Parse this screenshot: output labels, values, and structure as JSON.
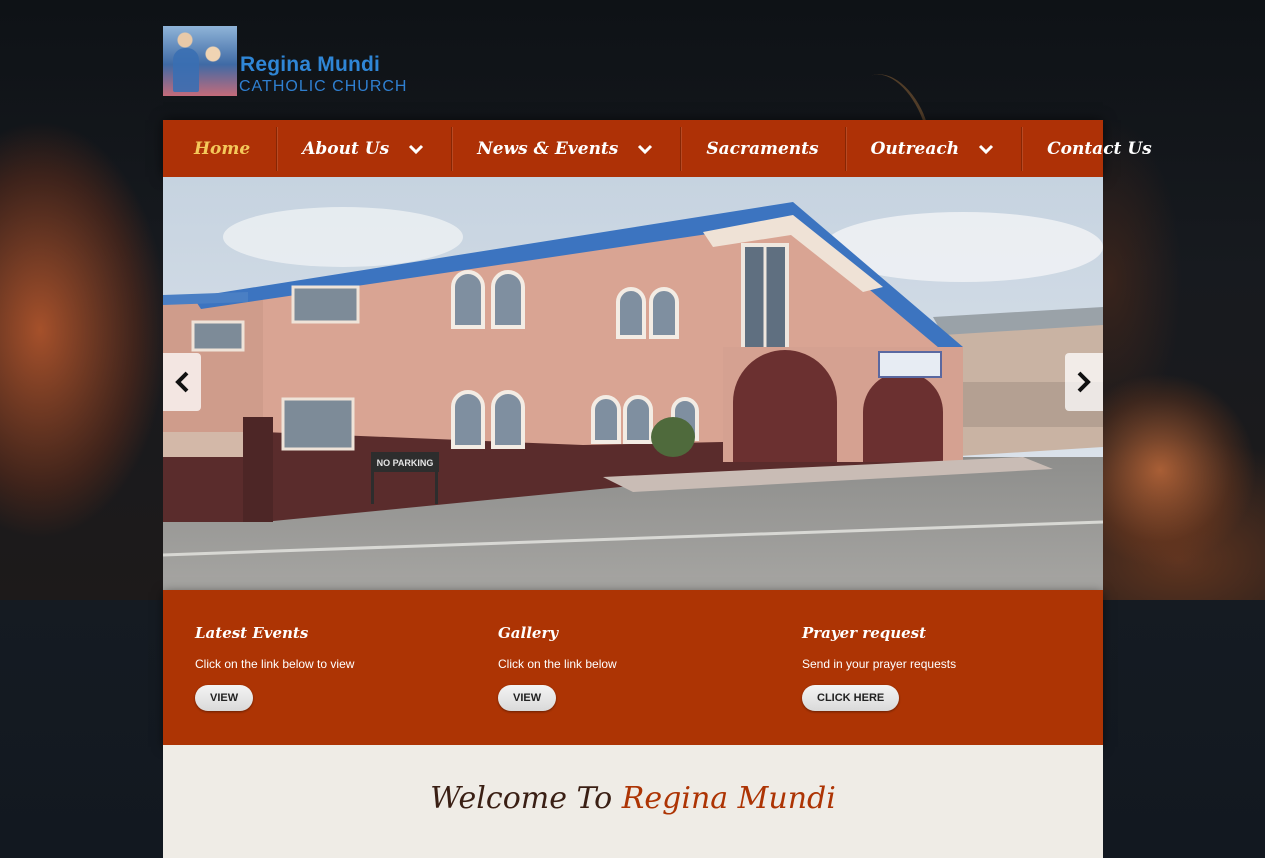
{
  "site": {
    "name_line1": "Regina Mundi",
    "name_line2": "CATHOLIC CHURCH"
  },
  "nav": {
    "items": [
      {
        "label": "Home",
        "active": true
      },
      {
        "label": "About Us",
        "dropdown": true
      },
      {
        "label": "News & Events",
        "dropdown": true
      },
      {
        "label": "Sacraments"
      },
      {
        "label": "Outreach",
        "dropdown": true
      },
      {
        "label": "Contact Us"
      }
    ]
  },
  "slider": {
    "sign_text": "NO PARKING"
  },
  "features": [
    {
      "title": "Latest Events",
      "text": "Click on the link below to view",
      "button": "VIEW"
    },
    {
      "title": "Gallery",
      "text": "Click on the link below",
      "button": "VIEW"
    },
    {
      "title": "Prayer request",
      "text": "Send in your prayer requests",
      "button": "CLICK HERE"
    }
  ],
  "welcome": {
    "prefix": "Welcome To",
    "name": "Regina Mundi"
  },
  "colors": {
    "nav_bg": "#ae3106",
    "active_nav": "#f4c85a",
    "band_bg": "#ad3404",
    "welcome_bg": "#efece6",
    "brand_blue": "#2f86d6"
  }
}
